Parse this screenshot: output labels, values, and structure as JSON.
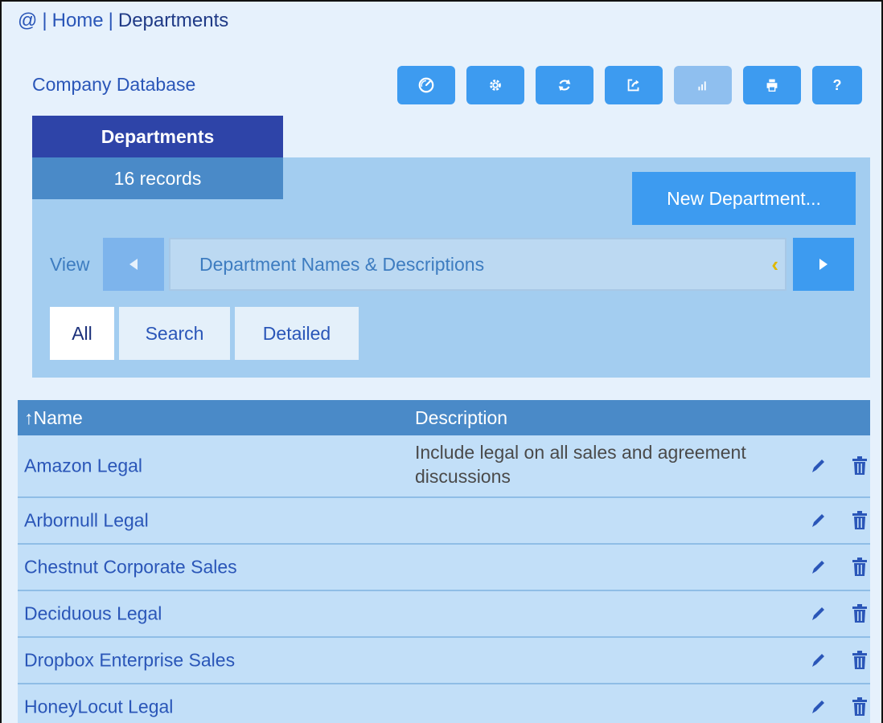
{
  "breadcrumb": {
    "at": "@",
    "home": "Home",
    "current": "Departments",
    "sep": "|"
  },
  "app": {
    "db_title": "Company Database"
  },
  "toolbar": {
    "buttons": [
      {
        "name": "dashboard",
        "icon": "gauge-icon"
      },
      {
        "name": "settings",
        "icon": "gear-icon"
      },
      {
        "name": "refresh",
        "icon": "refresh-icon"
      },
      {
        "name": "export",
        "icon": "export-icon"
      },
      {
        "name": "chart",
        "icon": "chart-icon",
        "disabled": true
      },
      {
        "name": "print",
        "icon": "print-icon"
      },
      {
        "name": "help",
        "icon": "help-icon",
        "label": "?"
      }
    ]
  },
  "tab": {
    "title": "Departments",
    "records": "16 records"
  },
  "actions": {
    "new_label": "New Department..."
  },
  "view": {
    "label": "View",
    "current": "Department Names & Descriptions",
    "indicator": "‹"
  },
  "filters": {
    "all": "All",
    "search": "Search",
    "detailed": "Detailed",
    "active": "All"
  },
  "table": {
    "headers": {
      "name": "↑Name",
      "description": "Description"
    },
    "rows": [
      {
        "name": "Amazon Legal",
        "description": "Include legal on all sales and agreement discussions"
      },
      {
        "name": "Arbornull Legal",
        "description": ""
      },
      {
        "name": "Chestnut Corporate Sales",
        "description": ""
      },
      {
        "name": "Deciduous Legal",
        "description": ""
      },
      {
        "name": "Dropbox Enterprise Sales",
        "description": ""
      },
      {
        "name": "HoneyLocut Legal",
        "description": ""
      }
    ]
  },
  "colors": {
    "accent": "#3d9bf0",
    "tab_dark": "#2e44a8",
    "panel": "#a3cdf0",
    "header": "#4a8ac8",
    "row": "#c2dff8"
  }
}
